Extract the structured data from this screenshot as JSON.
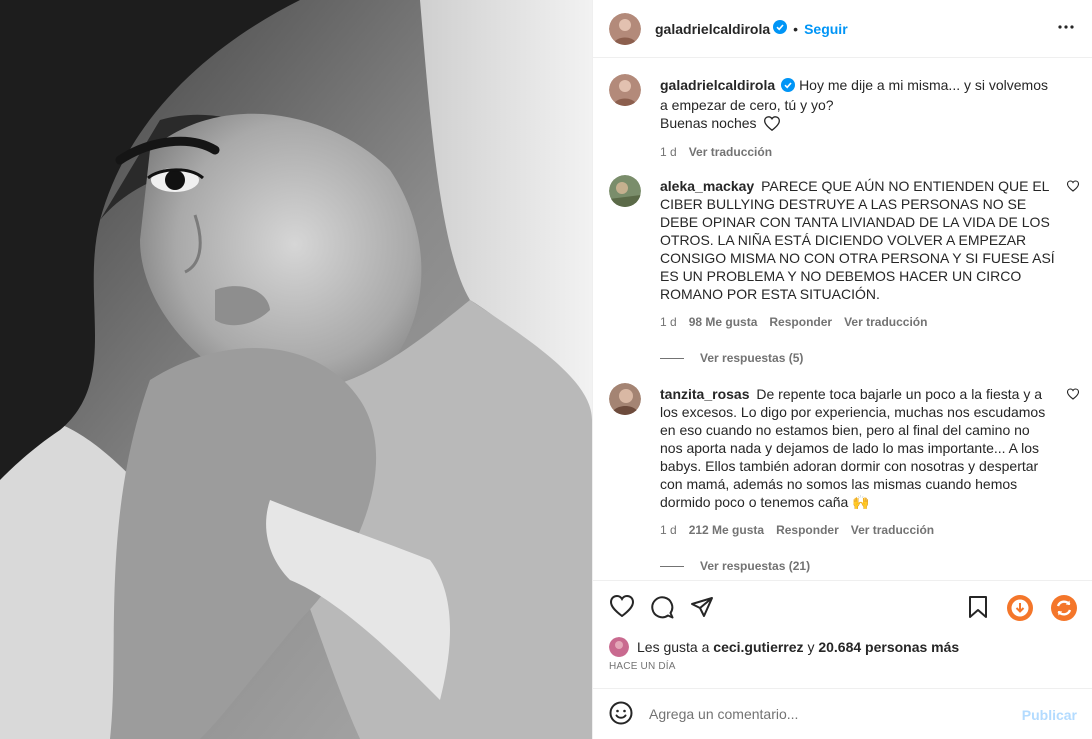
{
  "post": {
    "author": "galadrielcaldirola",
    "follow_label": "Seguir",
    "separator": "•"
  },
  "caption": {
    "username": "galadrielcaldirola",
    "text_line1": "Hoy me dije a mi misma... y si volvemos a empezar de cero, tú y yo?",
    "text_line2": "Buenas noches",
    "time": "1 d",
    "translate": "Ver traducción"
  },
  "comments": [
    {
      "username": "aleka_mackay",
      "text": "PARECE QUE AÚN NO ENTIENDEN QUE EL CIBER BULLYING DESTRUYE A LAS PERSONAS NO SE DEBE OPINAR CON TANTA LIVIANDAD DE LA VIDA DE LOS OTROS. LA NIÑA ESTÁ DICIENDO VOLVER A EMPEZAR CONSIGO MISMA NO CON OTRA PERSONA Y SI FUESE ASÍ ES UN PROBLEMA Y NO DEBEMOS HACER UN CIRCO ROMANO POR ESTA SITUACIÓN.",
      "time": "1 d",
      "likes": "98 Me gusta",
      "reply": "Responder",
      "translate": "Ver traducción",
      "view_replies": "Ver respuestas (5)"
    },
    {
      "username": "tanzita_rosas",
      "text": "De repente toca bajarle un poco a la fiesta y a los excesos. Lo digo por experiencia, muchas nos escudamos en eso cuando no estamos bien, pero al final del camino no nos aporta nada y dejamos de lado lo mas importante... A los babys. Ellos también adoran dormir con nosotras y despertar con mamá, además no somos las mismas cuando hemos dormido poco o tenemos caña",
      "emoji": "🙌",
      "time": "1 d",
      "likes": "212 Me gusta",
      "reply": "Responder",
      "translate": "Ver traducción",
      "view_replies": "Ver respuestas (21)"
    }
  ],
  "likes": {
    "prefix": "Les gusta a",
    "user": "ceci.gutierrez",
    "conj": "y",
    "others": "20.684 personas más"
  },
  "posted": "HACE UN DÍA",
  "composer": {
    "placeholder": "Agrega un comentario...",
    "publish": "Publicar"
  },
  "icons": {
    "like": "heart-icon",
    "comment": "comment-bubble-icon",
    "share": "paper-plane-icon",
    "save": "bookmark-icon",
    "ext1": "orange-download-icon",
    "ext2": "orange-sync-icon",
    "more": "more-horizontal-icon",
    "emoji": "smiley-icon"
  },
  "colors": {
    "accent": "#0095f6",
    "publish_disabled": "#b3dbff",
    "ext_orange": "#f4762a"
  }
}
